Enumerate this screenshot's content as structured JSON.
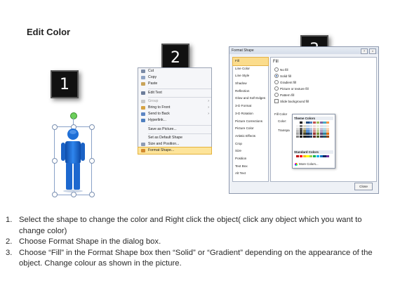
{
  "title": "Edit Color",
  "steps": [
    "1",
    "2",
    "3"
  ],
  "colors": {
    "figure": "#1f6fd6",
    "figure_dark": "#0d4ba8",
    "highlight": "#fde49a",
    "badge": "#111111"
  },
  "context_menu": {
    "items": [
      {
        "label": "Cut",
        "icon": "cut-icon"
      },
      {
        "label": "Copy",
        "icon": "copy-icon"
      },
      {
        "label": "Paste",
        "icon": "paste-icon"
      },
      {
        "label": "Edit Text",
        "icon": "edit-text-icon"
      },
      {
        "label": "Group",
        "icon": "group-icon",
        "disabled": true
      },
      {
        "label": "Bring to Front",
        "icon": "bring-front-icon"
      },
      {
        "label": "Send to Back",
        "icon": "send-back-icon"
      },
      {
        "label": "Hyperlink...",
        "icon": "hyperlink-icon"
      },
      {
        "label": "Save as Picture...",
        "icon": ""
      },
      {
        "label": "Set as Default Shape",
        "icon": ""
      },
      {
        "label": "Size and Position...",
        "icon": "size-icon"
      },
      {
        "label": "Format Shape...",
        "icon": "format-shape-icon",
        "highlighted": true
      }
    ]
  },
  "dialog": {
    "title": "Format Shape",
    "nav": [
      "Fill",
      "Line Color",
      "Line Style",
      "Shadow",
      "Reflection",
      "Glow and Soft Edges",
      "3-D Format",
      "3-D Rotation",
      "Picture Corrections",
      "Picture Color",
      "Artistic Effects",
      "Crop",
      "Size",
      "Position",
      "Text Box",
      "Alt Text"
    ],
    "fill_heading": "Fill",
    "fill_options": [
      {
        "label": "No fill",
        "checked": false
      },
      {
        "label": "Solid fill",
        "checked": true
      },
      {
        "label": "Gradient fill",
        "checked": false
      },
      {
        "label": "Picture or texture fill",
        "checked": false
      },
      {
        "label": "Pattern fill",
        "checked": false
      },
      {
        "label": "Slide background fill",
        "checked": false
      }
    ],
    "fill_color_label": "Fill Color",
    "color_label": "Color:",
    "transparency_label": "Transpa",
    "close_label": "Close"
  },
  "picker": {
    "theme_heading": "Theme Colors",
    "standard_heading": "Standard Colors",
    "more_colors": "More Colors...",
    "theme_top": [
      "#ffffff",
      "#000000",
      "#eeece1",
      "#1f497d",
      "#4f81bd",
      "#c0504d",
      "#9bbb59",
      "#8064a2",
      "#4bacc6",
      "#f79646"
    ],
    "theme_shades": [
      [
        "#f2f2f2",
        "#7f7f7f",
        "#ddd9c3",
        "#c6d9f0",
        "#dbe5f1",
        "#f2dcdb",
        "#ebf1dd",
        "#e5e0ec",
        "#dbeef3",
        "#fdeada"
      ],
      [
        "#d8d8d8",
        "#595959",
        "#c4bd97",
        "#8db3e2",
        "#b8cce4",
        "#e5b9b7",
        "#d7e3bc",
        "#ccc1d9",
        "#b7dde8",
        "#fbd5b5"
      ],
      [
        "#bfbfbf",
        "#3f3f3f",
        "#938953",
        "#548dd4",
        "#95b3d7",
        "#d99694",
        "#c3d69b",
        "#b2a2c7",
        "#92cddc",
        "#fac08f"
      ],
      [
        "#a5a5a5",
        "#262626",
        "#494429",
        "#17365d",
        "#366092",
        "#953734",
        "#76923c",
        "#5f497a",
        "#31859b",
        "#e36c09"
      ],
      [
        "#7f7f7f",
        "#0c0c0c",
        "#1d1b10",
        "#0f243e",
        "#244061",
        "#632423",
        "#4f6128",
        "#3f3151",
        "#205867",
        "#974806"
      ]
    ],
    "standard": [
      "#c00000",
      "#ff0000",
      "#ffc000",
      "#ffff00",
      "#92d050",
      "#00b050",
      "#00b0f0",
      "#0070c0",
      "#002060",
      "#7030a0"
    ]
  },
  "instructions": [
    {
      "num": "1.",
      "text": "Select the shape to change the color and Right click the object( click any object which you want to change color)"
    },
    {
      "num": "2.",
      "text": "Choose Format Shape in the dialog box."
    },
    {
      "num": "3.",
      "text": "Choose “Fill” in the Format Shape box then “Solid” or “Gradient” depending on the appearance of the object. Change colour as shown in the picture."
    }
  ]
}
